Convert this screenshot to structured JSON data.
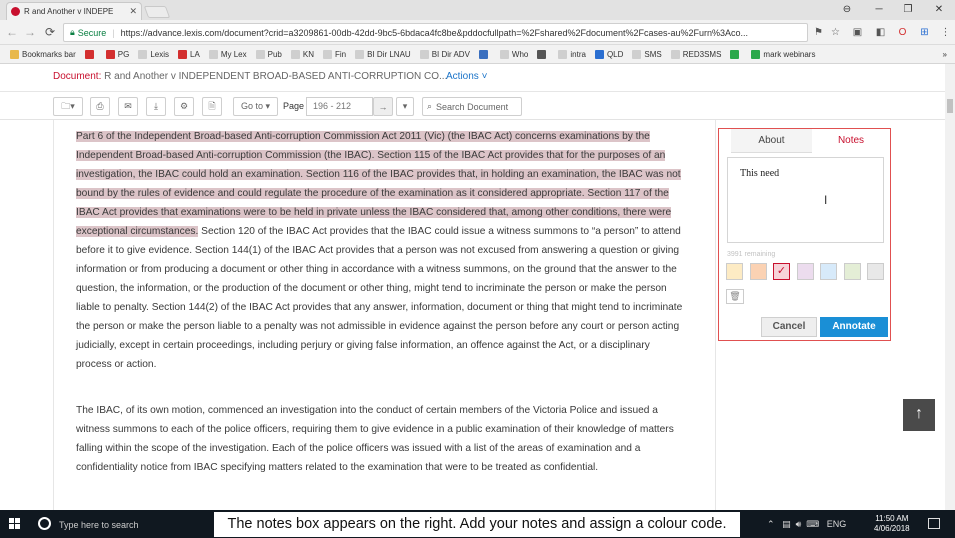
{
  "browser": {
    "tab_title": "R and Another v INDEPE",
    "tab_close": "✕",
    "window_controls": [
      "⊖",
      "─",
      "❐",
      "✕"
    ],
    "secure_label": "Secure",
    "url": "https://advance.lexis.com/document?crid=a3209861-00db-42dd-9bc5-6bdaca4fc8be&pddocfullpath=%2Fshared%2Fdocument%2Fcases-au%2Furn%3Aco...",
    "bookmarks": [
      {
        "label": "Bookmarks bar",
        "color": "#e8b84a"
      },
      {
        "label": "",
        "color": "#d32f2f"
      },
      {
        "label": "PG",
        "color": "#d32f2f"
      },
      {
        "label": "Lexis",
        "color": "#cfcfcf"
      },
      {
        "label": "LA",
        "color": "#d32f2f"
      },
      {
        "label": "My Lex",
        "color": "#cfcfcf"
      },
      {
        "label": "Pub",
        "color": "#cfcfcf"
      },
      {
        "label": "KN",
        "color": "#cfcfcf"
      },
      {
        "label": "Fin",
        "color": "#cfcfcf"
      },
      {
        "label": "BI Dir LNAU",
        "color": "#cfcfcf"
      },
      {
        "label": "BI Dir ADV",
        "color": "#cfcfcf"
      },
      {
        "label": "",
        "color": "#3a6fbf"
      },
      {
        "label": "Who",
        "color": "#cfcfcf"
      },
      {
        "label": "",
        "color": "#555555"
      },
      {
        "label": "intra",
        "color": "#cfcfcf"
      },
      {
        "label": "QLD",
        "color": "#2b6fd1"
      },
      {
        "label": "SMS",
        "color": "#cfcfcf"
      },
      {
        "label": "RED3SMS",
        "color": "#cfcfcf"
      },
      {
        "label": "",
        "color": "#2aa84a"
      },
      {
        "label": "mark webinars",
        "color": "#2aa84a"
      }
    ],
    "bookmarks_more": "»"
  },
  "document": {
    "title_label": "Document:",
    "title": "R and Another v INDEPENDENT BROAD-BASED ANTI-CORRUPTION CO...",
    "actions_label": "Actions ˅"
  },
  "toolbar": {
    "goto_label": "Go to ▾",
    "page_label": "Page",
    "page_range": "196 - 212",
    "search_placeholder": "Search Document"
  },
  "content": {
    "para1_highlighted": "Part 6 of the Independent Broad-based Anti-corruption Commission Act 2011 (Vic) (the IBAC Act) concerns examinations by the Independent Broad-based Anti-corruption Commission (the IBAC). Section 115 of the IBAC Act provides that for the purposes of an investigation, the IBAC could hold an examination. Section 116 of the IBAC provides that, in holding an examination, the IBAC was not bound by the rules of evidence and could regulate the procedure of the examination as it considered appropriate. Section 117 of the IBAC Act provides that examinations were to be held in private unless the IBAC considered that, among other conditions, there were exceptional circumstances.",
    "para1_rest": " Section 120 of the IBAC Act provides that the IBAC could issue a witness summons to “a person” to attend before it to give evidence. Section 144(1) of the IBAC Act provides that a person was not excused from answering a question or giving information or from producing a document or other thing in accordance with a witness summons, on the ground that the answer to the question, the information, or the production of the document or other thing, might tend to incriminate the person or make the person liable to penalty. Section 144(2) of the IBAC Act provides that any answer, information, document or thing that might tend to incriminate the person or make the person liable to a penalty was not admissible in evidence against the person before any court or person acting judicially, except in certain proceedings, including perjury or giving false information, an offence against the Act, or a disciplinary process or action.",
    "para2": "The IBAC, of its own motion, commenced an investigation into the conduct of certain members of the Victoria Police and issued a witness summons to each of the police officers, requiring them to give evidence in a public examination of their knowledge of matters falling within the scope of the investigation. Each of the police officers was issued with a list of the areas of examination and a confidentiality notice from IBAC specifying matters related to the examination that were to be treated as confidential."
  },
  "notes_panel": {
    "tab_about": "About",
    "tab_notes": "Notes",
    "note_text": "This need",
    "remaining": "3991 remaining",
    "swatches": [
      "#fdebc4",
      "#fbd2b3",
      "#f7d3d9",
      "#ecdcee",
      "#d7eafa",
      "#e4eed6",
      "#e8e8e8"
    ],
    "selected_swatch_index": 2,
    "cancel_label": "Cancel",
    "annotate_label": "Annotate"
  },
  "taskbar": {
    "search_hint": "Type here to search",
    "lang": "ENG",
    "time": "11:50 AM",
    "date": "4/06/2018"
  },
  "caption": "The notes box appears on the right. Add your notes and assign a colour code."
}
